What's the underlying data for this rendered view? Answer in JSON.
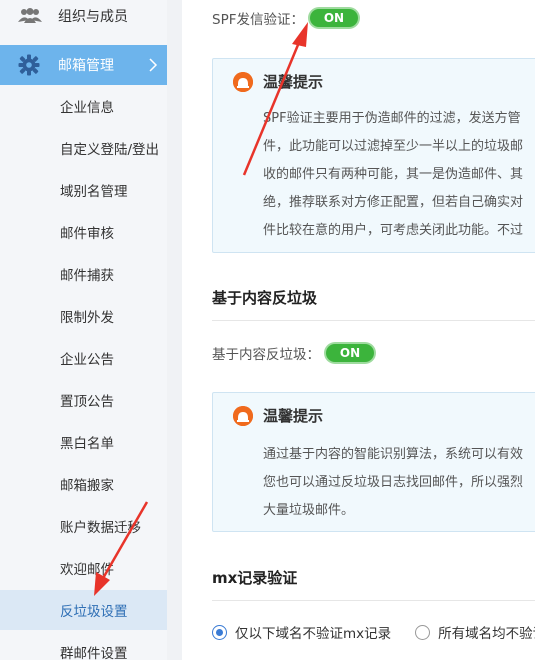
{
  "sidebar": {
    "org_label": "组织与成员",
    "mgmt_label": "邮箱管理",
    "items": [
      {
        "label": "企业信息"
      },
      {
        "label": "自定义登陆/登出"
      },
      {
        "label": "域别名管理"
      },
      {
        "label": "邮件审核"
      },
      {
        "label": "邮件捕获"
      },
      {
        "label": "限制外发"
      },
      {
        "label": "企业公告"
      },
      {
        "label": "置顶公告"
      },
      {
        "label": "黑白名单"
      },
      {
        "label": "邮箱搬家"
      },
      {
        "label": "账户数据迁移"
      },
      {
        "label": "欢迎邮件"
      },
      {
        "label": "反垃圾设置"
      },
      {
        "label": "群邮件设置"
      }
    ]
  },
  "spf": {
    "label": "SPF发信验证：",
    "toggle": "ON",
    "tip_title": "温馨提示",
    "tip_lines": [
      "SPF验证主要用于伪造邮件的过滤，发送方管",
      "件，此功能可以过滤掉至少一半以上的垃圾邮",
      "收的邮件只有两种可能，其一是伪造邮件、其",
      "绝，推荐联系对方修正配置，但若自己确实对",
      "件比较在意的用户，可考虑关闭此功能。不过"
    ]
  },
  "content_filter": {
    "section_title": "基于内容反垃圾",
    "label": "基于内容反垃圾：",
    "toggle": "ON",
    "tip_title": "温馨提示",
    "tip_lines": [
      "通过基于内容的智能识别算法，系统可以有效",
      "您也可以通过反垃圾日志找回邮件，所以强烈",
      "大量垃圾邮件。"
    ]
  },
  "mx": {
    "section_title": "mx记录验证",
    "option1": "仅以下域名不验证mx记录",
    "option2": "所有域名均不验证"
  },
  "colors": {
    "toggle_on": "#3cb43c",
    "active_menu": "#6db4ec",
    "arrow": "#e8342a",
    "warn_icon": "#f06a1d"
  }
}
